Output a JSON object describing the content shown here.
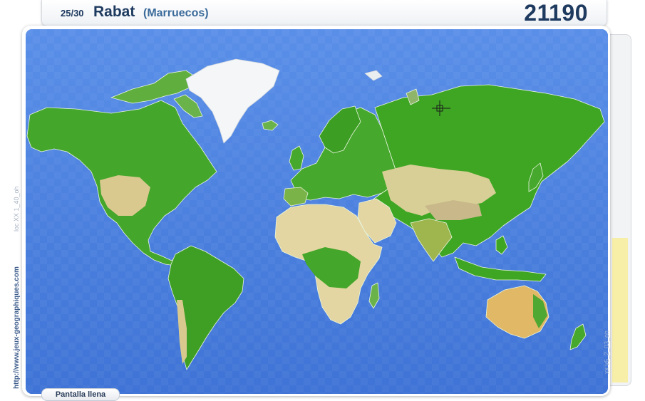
{
  "question": {
    "progress": "25/30",
    "city": "Rabat",
    "country": "(Marruecos)"
  },
  "score": "21190",
  "timer": {
    "remaining_fraction": 0.42,
    "fill_color": "#f7eea8"
  },
  "map": {
    "ocean_color": "#4b82e2",
    "lowland_color": "#3fa624",
    "desert_color": "#e3d6a2",
    "ice_color": "#f4f6f8",
    "crosshair_icon": "crosshair-icon"
  },
  "side": {
    "url": "http://www.jeux-geographiques.com",
    "loc_code": "loc XX 1_40_oh",
    "map_code": "xx v6_2_03_oh"
  },
  "buttons": {
    "fullscreen": "Pantalla llena"
  }
}
